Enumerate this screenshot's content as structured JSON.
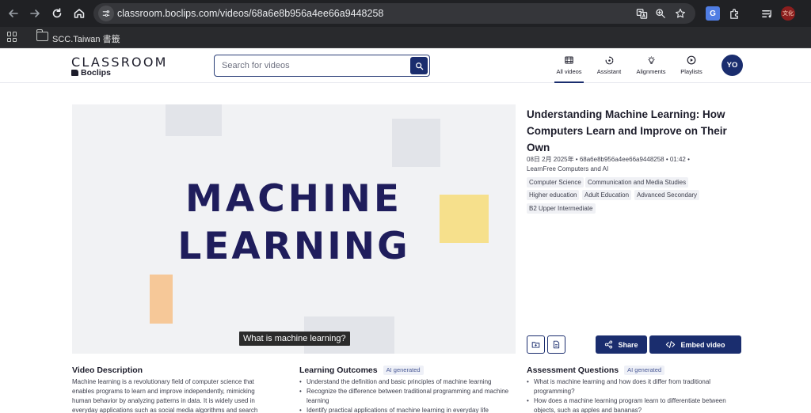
{
  "browser": {
    "url": "classroom.boclips.com/videos/68a6e8b956a4ee66a9448258",
    "bookmark_folder": "SCC.Taiwan 書籤",
    "profile_label": "文化"
  },
  "header": {
    "logo_top": "CLASSROOM",
    "logo_bottom": "Boclips",
    "search_placeholder": "Search for videos",
    "nav": [
      {
        "label": "All videos",
        "icon": "video-icon"
      },
      {
        "label": "Assistant",
        "icon": "assistant-icon"
      },
      {
        "label": "Alignments",
        "icon": "lightbulb-icon"
      },
      {
        "label": "Playlists",
        "icon": "play-circle-icon"
      }
    ],
    "avatar_initials": "YO"
  },
  "video": {
    "line1": "MACHINE",
    "line2": "LEARNING",
    "caption": "What is machine learning?"
  },
  "details": {
    "title": "Understanding Machine Learning: How Computers Learn and Improve on Their Own",
    "meta_line1": "08日 2月 2025年 • 68a6e8b956a4ee66a9448258 • 01:42 •",
    "meta_line2": "LearnFree Computers and AI",
    "tags": [
      "Computer Science",
      "Communication and Media Studies",
      "Higher education",
      "Adult Education",
      "Advanced Secondary",
      "B2 Upper Intermediate"
    ],
    "share_label": "Share",
    "embed_label": "Embed video"
  },
  "description": {
    "heading": "Video Description",
    "lines": [
      "Machine learning is a revolutionary field of computer science that",
      "enables programs to learn and improve independently, mimicking",
      "human behavior by analyzing patterns in data. It is widely used in",
      "everyday applications such as social media algorithms and search"
    ]
  },
  "outcomes": {
    "heading": "Learning Outcomes",
    "badge": "AI generated",
    "items": [
      "Understand the definition and basic principles of machine learning",
      "Recognize the difference between traditional programming and machine learning",
      "Identify practical applications of machine learning in everyday life"
    ]
  },
  "assessment": {
    "heading": "Assessment Questions",
    "badge": "AI generated",
    "items": [
      "What is machine learning and how does it differ from traditional programming?",
      "How does a machine learning program learn to differentiate between objects, such as apples and bananas?"
    ]
  },
  "colors": {
    "brand_navy": "#1a2d6e",
    "title_navy": "#1f1d5c",
    "deco_yellow": "#f6e08c",
    "deco_orange": "#f6c898",
    "deco_grey": "#e2e4e9"
  }
}
